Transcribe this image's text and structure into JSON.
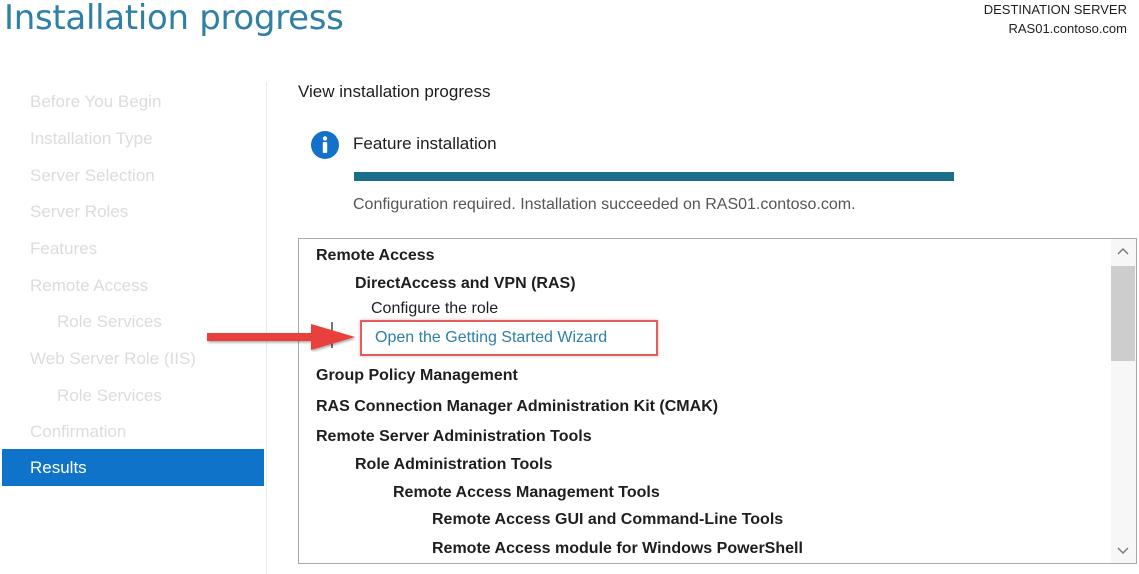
{
  "page_title": "Installation progress",
  "destination": {
    "label": "DESTINATION SERVER",
    "server": "RAS01.contoso.com"
  },
  "sidebar": {
    "items": [
      {
        "label": "Before You Begin"
      },
      {
        "label": "Installation Type"
      },
      {
        "label": "Server Selection"
      },
      {
        "label": "Server Roles"
      },
      {
        "label": "Features"
      },
      {
        "label": "Remote Access"
      },
      {
        "label": "Role Services"
      },
      {
        "label": "Web Server Role (IIS)"
      },
      {
        "label": "Role Services"
      },
      {
        "label": "Confirmation"
      },
      {
        "label": "Results"
      }
    ],
    "active": "Results"
  },
  "main": {
    "heading": "View installation progress",
    "feature_label": "Feature installation",
    "progress_percent": 100,
    "status_message": "Configuration required. Installation succeeded on RAS01.contoso.com.",
    "tree": [
      {
        "label": "Remote Access"
      },
      {
        "label": "DirectAccess and VPN (RAS)"
      },
      {
        "label": "Configure the role"
      },
      {
        "label": "Open the Getting Started Wizard"
      },
      {
        "label": "Group Policy Management"
      },
      {
        "label": "RAS Connection Manager Administration Kit (CMAK)"
      },
      {
        "label": "Remote Server Administration Tools"
      },
      {
        "label": "Role Administration Tools"
      },
      {
        "label": "Remote Access Management Tools"
      },
      {
        "label": "Remote Access GUI and Command-Line Tools"
      },
      {
        "label": "Remote Access module for Windows PowerShell"
      }
    ]
  },
  "icons": {
    "info": "info-icon",
    "arrow": "red-arrow-icon",
    "scroll_up": "chevron-up-icon",
    "scroll_down": "chevron-down-icon"
  },
  "colors": {
    "accent": "#2f7fa6",
    "progress": "#1a6e8c",
    "active_item": "#0f74c9",
    "highlight": "#e25d5d"
  }
}
